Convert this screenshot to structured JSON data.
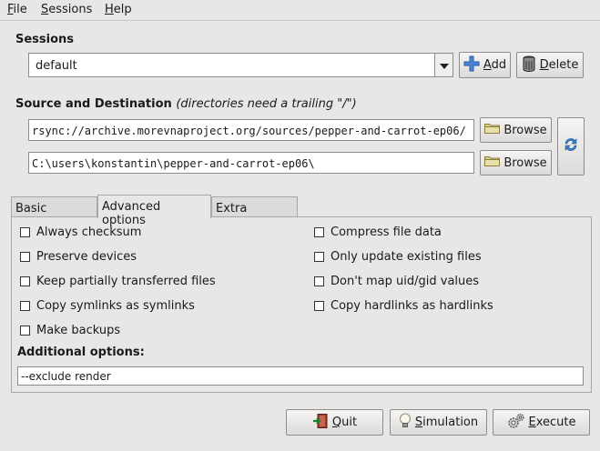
{
  "menubar": {
    "file": {
      "mnemonic": "F",
      "rest": "ile"
    },
    "sessions": {
      "mnemonic": "S",
      "rest": "essions"
    },
    "help": {
      "mnemonic": "H",
      "rest": "elp"
    }
  },
  "sessions": {
    "title": "Sessions",
    "selected": "default",
    "add_label": {
      "mnemonic": "A",
      "rest": "dd"
    },
    "delete_label": {
      "mnemonic": "D",
      "rest": "elete"
    }
  },
  "source_dest": {
    "title": "Source and Destination",
    "note": "(directories need a trailing \"/\")",
    "source_value": "rsync://archive.morevnaproject.org/sources/pepper-and-carrot-ep06/",
    "dest_value": "C:\\users\\konstantin\\pepper-and-carrot-ep06\\",
    "browse_label": "Browse"
  },
  "tabs": [
    {
      "label": "Basic options"
    },
    {
      "label": "Advanced options"
    },
    {
      "label": "Extra options"
    }
  ],
  "options_left": [
    {
      "label": "Always checksum",
      "checked": false
    },
    {
      "label": "Preserve devices",
      "checked": false
    },
    {
      "label": "Keep partially transferred files",
      "checked": false
    },
    {
      "label": "Copy symlinks as symlinks",
      "checked": false
    },
    {
      "label": "Make backups",
      "checked": false
    }
  ],
  "options_right": [
    {
      "label": "Compress file data",
      "checked": false
    },
    {
      "label": "Only update existing files",
      "checked": false
    },
    {
      "label": "Don't map uid/gid values",
      "checked": false
    },
    {
      "label": "Copy hardlinks as hardlinks",
      "checked": false
    }
  ],
  "additional": {
    "title": "Additional options:",
    "value": "--exclude render"
  },
  "actions": {
    "quit": {
      "mnemonic": "Q",
      "rest": "uit"
    },
    "simulation": {
      "mnemonic": "S",
      "rest": "imulation"
    },
    "execute": {
      "mnemonic": "E",
      "rest": "xecute"
    }
  },
  "colors": {
    "window_bg": "#e8e7e5",
    "accent_blue": "#3d7fcf"
  }
}
